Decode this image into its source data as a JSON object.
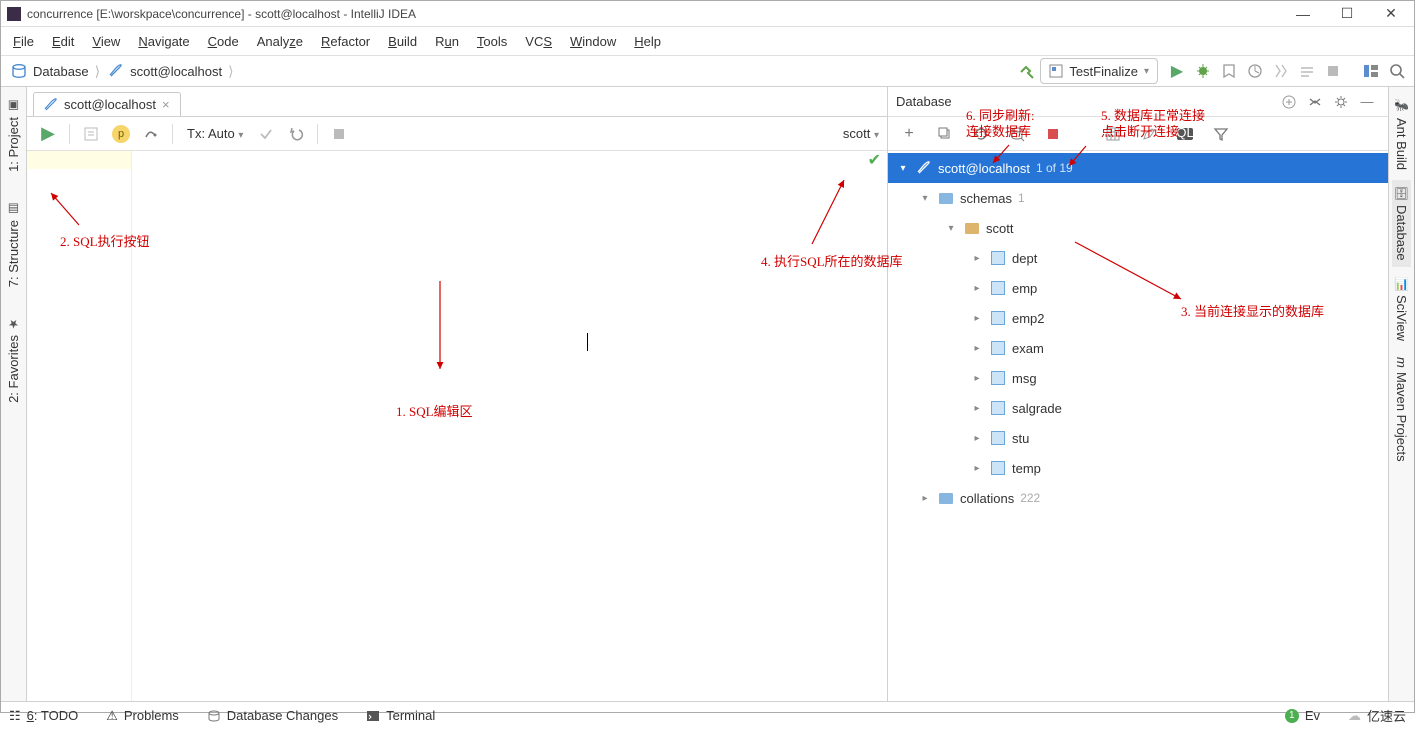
{
  "window": {
    "title": "concurrence [E:\\worskpace\\concurrence] - scott@localhost - IntelliJ IDEA"
  },
  "menu": {
    "file": "File",
    "edit": "Edit",
    "view": "View",
    "navigate": "Navigate",
    "code": "Code",
    "analyze": "Analyze",
    "refactor": "Refactor",
    "build": "Build",
    "run": "Run",
    "tools": "Tools",
    "vcs": "VCS",
    "window": "Window",
    "help": "Help"
  },
  "breadcrumb": {
    "a": "Database",
    "b": "scott@localhost"
  },
  "run_config": {
    "name": "TestFinalize"
  },
  "left_tabs": {
    "project": "1: Project",
    "structure": "7: Structure",
    "favorites": "2: Favorites"
  },
  "right_tabs": {
    "ant": "Ant Build",
    "database": "Database",
    "sciview": "SciView",
    "maven": "Maven Projects"
  },
  "editor": {
    "tab_label": "scott@localhost",
    "tx_label": "Tx: Auto",
    "schema_selector": "scott"
  },
  "db_panel": {
    "title": "Database",
    "root": {
      "label": "scott@localhost",
      "count": "1 of 19"
    },
    "schemas": {
      "label": "schemas",
      "count": "1"
    },
    "schema": "scott",
    "tables": [
      "dept",
      "emp",
      "emp2",
      "exam",
      "msg",
      "salgrade",
      "stu",
      "temp"
    ],
    "collations": {
      "label": "collations",
      "count": "222"
    }
  },
  "status": {
    "todo": "6: TODO",
    "problems": "Problems",
    "dbchanges": "Database Changes",
    "terminal": "Terminal",
    "ev": "Ev",
    "brand": "亿速云"
  },
  "annotations": {
    "a1": "1.  SQL编辑区",
    "a2": "2. SQL执行按钮",
    "a3": "3. 当前连接显示的数据库",
    "a4": "4. 执行SQL所在的数据库",
    "a5": "5. 数据库正常连接\n点击断开连接",
    "a6": "6. 同步刷新:\n连接数据库"
  }
}
